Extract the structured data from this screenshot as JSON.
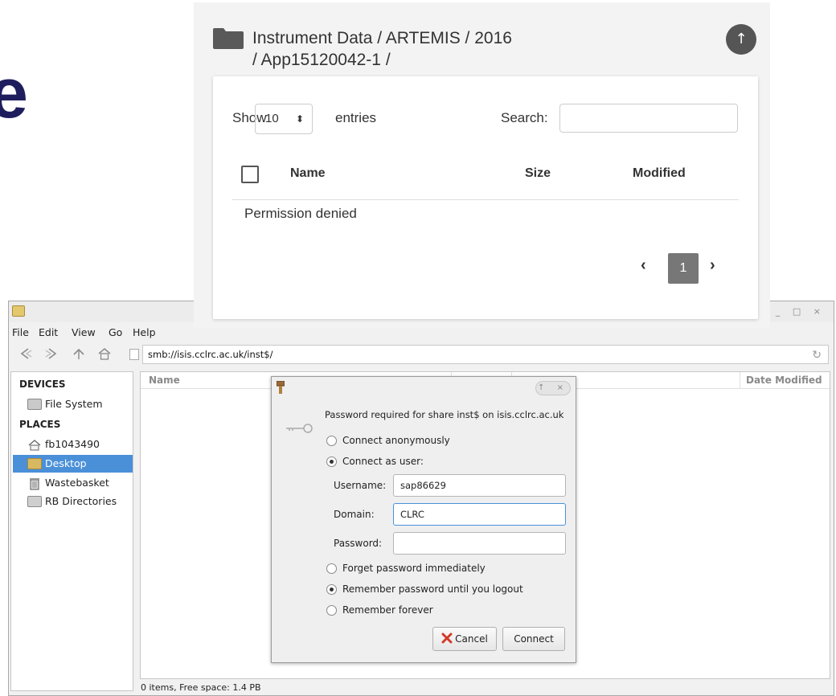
{
  "logo": {
    "letter": "e"
  },
  "web": {
    "breadcrumb_line1": "Instrument Data / ARTEMIS / 2016",
    "breadcrumb_line2": "/ App15120042-1 /",
    "up_icon": "↑",
    "show_label": "Show",
    "entries_value": "10",
    "entries_label": "entries",
    "search_label": "Search:",
    "search_value": "",
    "columns": [
      "Name",
      "Size",
      "Modified"
    ],
    "empty_message": "Permission denied",
    "page_current": "1",
    "prev_icon": "‹",
    "next_icon": "›"
  },
  "filemanager": {
    "menu": [
      "File",
      "Edit",
      "View",
      "Go",
      "Help"
    ],
    "address": "smb://isis.cclrc.ac.uk/inst$/",
    "window_controls": "↑ _ □ ×",
    "sidebar": {
      "devices_heading": "DEVICES",
      "devices": [
        {
          "label": "File System",
          "icon": "drive-icon"
        }
      ],
      "places_heading": "PLACES",
      "places": [
        {
          "label": "fb1043490",
          "icon": "home-icon"
        },
        {
          "label": "Desktop",
          "icon": "folder-icon",
          "selected": true
        },
        {
          "label": "Wastebasket",
          "icon": "trash-icon"
        },
        {
          "label": "RB Directories",
          "icon": "network-folder-icon"
        }
      ]
    },
    "list_columns": {
      "name": "Name",
      "date_modified": "Date Modified"
    },
    "status": "0 items, Free space: 1.4 PB"
  },
  "dialog": {
    "message": "Password required for share inst$ on isis.cclrc.ac.uk",
    "connect_anon": "Connect anonymously",
    "connect_user": "Connect as user:",
    "username_label": "Username:",
    "username_value": "sap86629",
    "domain_label": "Domain:",
    "domain_value": "CLRC",
    "password_label": "Password:",
    "password_value": "",
    "forget": "Forget password immediately",
    "remember_logout": "Remember password until you logout",
    "remember_forever": "Remember forever",
    "cancel": "Cancel",
    "connect": "Connect",
    "title_controls": "↑ ×"
  }
}
